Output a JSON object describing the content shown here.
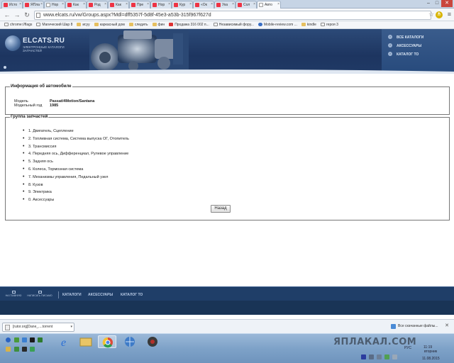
{
  "browser": {
    "tabs": [
      {
        "label": "Исто",
        "icon": "red"
      },
      {
        "label": "ЯПла",
        "icon": "red"
      },
      {
        "label": "Нор",
        "icon": "doc"
      },
      {
        "label": "Как",
        "icon": "red"
      },
      {
        "label": "Род",
        "icon": "red"
      },
      {
        "label": "Как",
        "icon": "red"
      },
      {
        "label": "Пре",
        "icon": "red"
      },
      {
        "label": "Нор",
        "icon": "red"
      },
      {
        "label": "Кур",
        "icon": "red"
      },
      {
        "label": "«Ок",
        "icon": "red"
      },
      {
        "label": "Ука",
        "icon": "red"
      },
      {
        "label": "Сол",
        "icon": "red"
      },
      {
        "label": "Авто",
        "icon": "doc",
        "active": true
      }
    ],
    "url": "www.elcats.ru/vw/Groups.aspx?Mdl=dff5357f-5d8f-45e3-a53b-315f967f627d",
    "bookmarks": [
      {
        "label": "chrome://flags",
        "icon": "page"
      },
      {
        "label": "Магический Шар 8",
        "icon": "page"
      },
      {
        "label": "исуу",
        "icon": "folder"
      },
      {
        "label": "каркасный дом",
        "icon": "folder"
      },
      {
        "label": "следить",
        "icon": "folder"
      },
      {
        "label": "фин",
        "icon": "folder"
      },
      {
        "label": "Продажа 316 002 п...",
        "icon": "red"
      },
      {
        "label": "Независимый фору...",
        "icon": "page"
      },
      {
        "label": "Mobile-review.com ...",
        "icon": "mob"
      },
      {
        "label": "kindle",
        "icon": "folder"
      },
      {
        "label": "героя 3",
        "icon": "page"
      }
    ]
  },
  "site": {
    "logo_title": "ELCATS.RU",
    "logo_subtitle": "ЭЛЕКТРОННЫЕ КАТАЛОГИ ЗАПЧАСТЕЙ",
    "header_links": [
      "ВСЕ КАТАЛОГИ",
      "АКСЕССУАРЫ",
      "КАТАЛОГ ТО"
    ]
  },
  "car_info": {
    "legend": "Информация об автомобиле",
    "model_label": "Модель",
    "model_value": "Passat/4Motion/Santana",
    "year_label": "Модельный год",
    "year_value": "1985"
  },
  "parts": {
    "legend": "Группа запчастей",
    "items": [
      "1. Двигатель, Сцепление",
      "2. Топливная система, Система выпуска ОГ, Отопитель",
      "3. Трансмиссия",
      "4. Передняя ось, Дифференциал, Рулевое управление",
      "5. Задняя ось",
      "6. Колеса, Тормозная система",
      "7. Механизмы управления, Педальный узел",
      "8. Кузов",
      "9. Электрика",
      "0. Аксессуары"
    ],
    "back_label": "Назад"
  },
  "footer": {
    "small_home": "НА ГЛАВНУЮ",
    "small_mail": "НАПИСАТЬ ПИСЬМО",
    "links": [
      "КАТАЛОГИ",
      "АКСЕССУАРЫ",
      "КАТАЛОГ ТО"
    ]
  },
  "downloads": {
    "item": "[rutor.org]Dane_....torrent",
    "show_all": "Все скачанные файлы..."
  },
  "taskbar": {
    "watermark": "ЯПЛАКАЛ.COM",
    "lang": "РУС",
    "time": "11:19",
    "day": "вторник",
    "date": "11.08.2015"
  },
  "colors": {
    "header_bg": "#1d3560",
    "footer_bg": "#1f3e68",
    "taskbar": "#7ea2c8"
  }
}
